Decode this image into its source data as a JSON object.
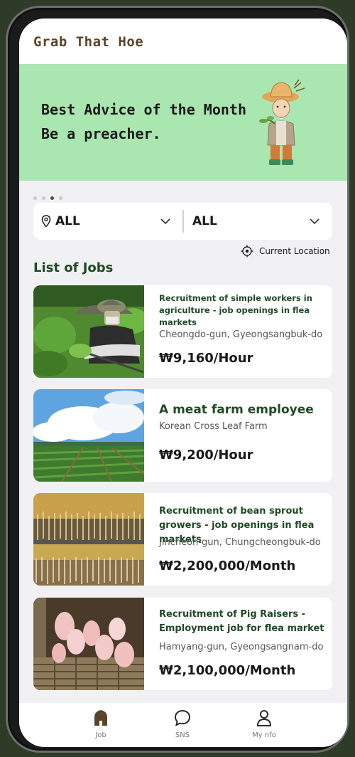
{
  "app": {
    "title": "Grab That Hoe"
  },
  "banner": {
    "line1": "Best Advice of the Month",
    "line2": "Be a preacher.",
    "slides": 4,
    "active_slide": 3
  },
  "filters": {
    "region": {
      "value": "ALL",
      "icon": "location-pin-icon"
    },
    "city": {
      "value": "ALL"
    }
  },
  "current_location": {
    "label": "Current Location",
    "icon": "target-icon"
  },
  "jobs_section": {
    "title": "List of Jobs",
    "jobs": [
      {
        "title": "Recruitment of simple workers in agriculture - job openings in flea markets",
        "location": "Cheongdo-gun, Gyeongsangbuk-do",
        "pay": "₩9,160/Hour",
        "image": "worker-in-field-photo"
      },
      {
        "title": "A meat farm employee",
        "location": "Korean Cross Leaf Farm",
        "pay": "₩9,200/Hour",
        "image": "farm-field-sky-photo"
      },
      {
        "title": "Recruitment of bean sprout growers - job openings in flea markets",
        "location": "Jincheon-gun, Chungcheongbuk-do",
        "pay": "₩2,200,000/Month",
        "image": "bean-sprouts-photo"
      },
      {
        "title": "Recruitment of Pig Raisers - Employment job for flea market",
        "location": "Hamyang-gun, Gyeongsangnam-do",
        "pay": "₩2,100,000/Month",
        "image": "piglets-photo"
      }
    ]
  },
  "bottom_nav": {
    "items": [
      {
        "label": "Job",
        "icon": "home-icon",
        "active": true
      },
      {
        "label": "SNS",
        "icon": "chat-bubble-icon",
        "active": false
      },
      {
        "label": "My nfo",
        "icon": "person-icon",
        "active": false
      }
    ]
  },
  "colors": {
    "banner": "#a9e6b0",
    "title_green": "#1f4a24",
    "brand_brown": "#5a4428",
    "background": "#f1f1f3"
  }
}
